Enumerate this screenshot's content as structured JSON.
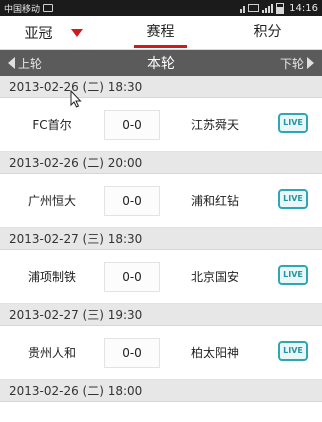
{
  "status_bar": {
    "carrier": "中国移动",
    "time": "14:16"
  },
  "nav": {
    "league": "亚冠",
    "tabs": [
      {
        "label": "赛程",
        "active": true
      },
      {
        "label": "积分",
        "active": false
      }
    ]
  },
  "round": {
    "prev": "上轮",
    "current": "本轮",
    "next": "下轮"
  },
  "matches": [
    {
      "date": "2013-02-26 (二) 18:30",
      "home": "FC首尔",
      "score": "0-0",
      "away": "江苏舜天",
      "live": "LIVE"
    },
    {
      "date": "2013-02-26 (二) 20:00",
      "home": "广州恒大",
      "score": "0-0",
      "away": "浦和红钻",
      "live": "LIVE"
    },
    {
      "date": "2013-02-27 (三) 18:30",
      "home": "浦项制铁",
      "score": "0-0",
      "away": "北京国安",
      "live": "LIVE"
    },
    {
      "date": "2013-02-27 (三) 19:30",
      "home": "贵州人和",
      "score": "0-0",
      "away": "柏太阳神",
      "live": "LIVE"
    }
  ],
  "next_date": "2013-02-26 (二) 18:00",
  "colors": {
    "accent": "#d11a1a",
    "live": "#2fa6b3",
    "roundbar": "#5b5b5b",
    "date_bg": "#e7e7e7"
  }
}
